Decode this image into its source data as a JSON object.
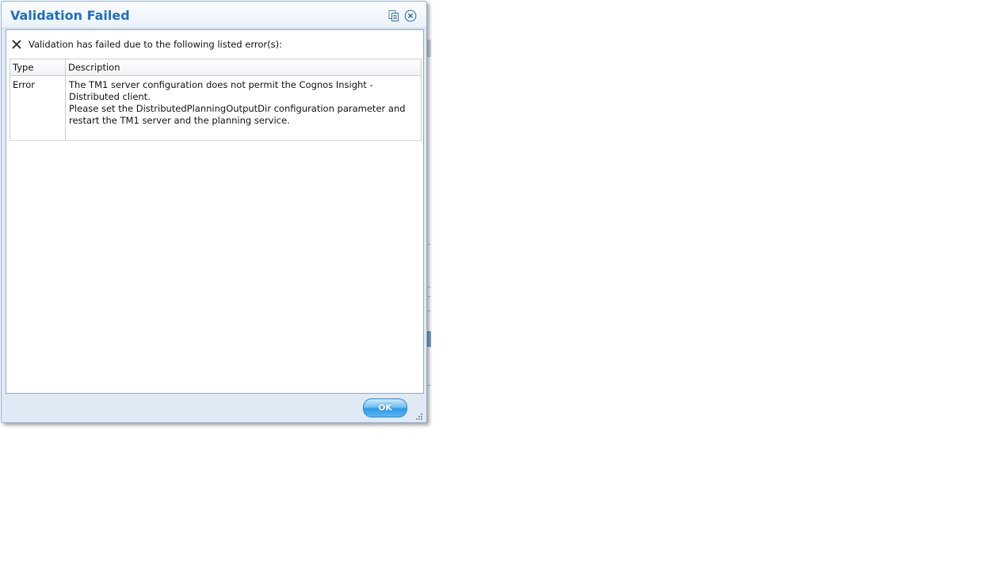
{
  "dialog": {
    "title": "Validation Failed",
    "message": "Validation has failed due to the following listed error(s):",
    "ok_label": "OK",
    "icons": {
      "copy": "copy-icon",
      "close": "close-icon",
      "error": "x-icon",
      "resize": "resize-grip-icon"
    }
  },
  "table": {
    "columns": [
      "Type",
      "Description"
    ],
    "rows": [
      {
        "type": "Error",
        "description_line1": "The TM1 server configuration does not permit the Cognos Insight - Distributed client.",
        "description_line2": "Please set the DistributedPlanningOutputDir configuration parameter and restart the TM1 server and the planning service."
      }
    ]
  },
  "colors": {
    "title": "#1e6fc4",
    "accent": "#2f9be6"
  }
}
